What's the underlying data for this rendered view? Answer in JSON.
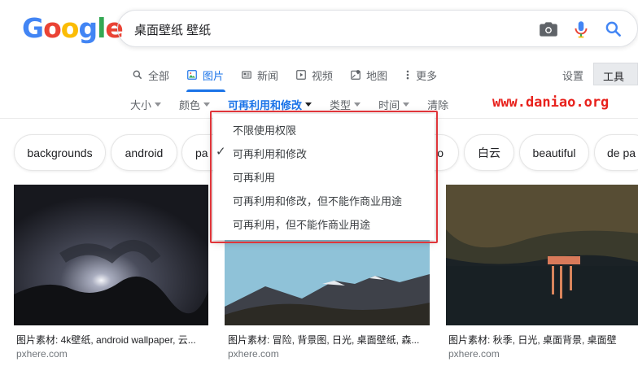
{
  "logo": {
    "letters": [
      "G",
      "o",
      "o",
      "g",
      "l",
      "e"
    ],
    "colors": [
      "#4285f4",
      "#ea4335",
      "#fbbc05",
      "#4285f4",
      "#34a853",
      "#ea4335"
    ]
  },
  "search": {
    "query": "桌面壁纸 壁纸"
  },
  "tabs": [
    {
      "label": "全部",
      "icon": "search-icon"
    },
    {
      "label": "图片",
      "icon": "image-icon",
      "active": true
    },
    {
      "label": "新闻",
      "icon": "news-icon"
    },
    {
      "label": "视频",
      "icon": "video-icon"
    },
    {
      "label": "地图",
      "icon": "map-icon"
    },
    {
      "label": "更多",
      "icon": "more-vert-icon"
    }
  ],
  "toolbar": {
    "settings_label": "设置",
    "tools_label": "工具"
  },
  "filters": [
    {
      "label": "大小"
    },
    {
      "label": "颜色"
    },
    {
      "label": "可再利用和修改",
      "active": true
    },
    {
      "label": "类型"
    },
    {
      "label": "时间"
    },
    {
      "label": "清除"
    }
  ],
  "watermark": "www.daniao.org",
  "chips": [
    "backgrounds",
    "android",
    "pa",
    "o",
    "白云",
    "beautiful",
    "de pa"
  ],
  "dropdown": {
    "items": [
      {
        "label": "不限使用权限",
        "checked": false
      },
      {
        "label": "可再利用和修改",
        "checked": true
      },
      {
        "label": "可再利用",
        "checked": false
      },
      {
        "label": "可再利用和修改，但不能作商业用途",
        "checked": false
      },
      {
        "label": "可再利用，但不能作商业用途",
        "checked": false
      }
    ],
    "check_glyph": "✓"
  },
  "results": [
    {
      "caption": "图片素材: 4k壁纸, android wallpaper, 云...",
      "domain": "pxhere.com"
    },
    {
      "caption": "图片素材: 冒险, 背景图, 日光, 桌面壁纸, 森...",
      "domain": "pxhere.com"
    },
    {
      "caption": "图片素材: 秋季, 日光, 桌面背景, 桌面壁",
      "domain": "pxhere.com"
    }
  ],
  "accent": "#1a73e8",
  "highlight_border": "#e0353a"
}
